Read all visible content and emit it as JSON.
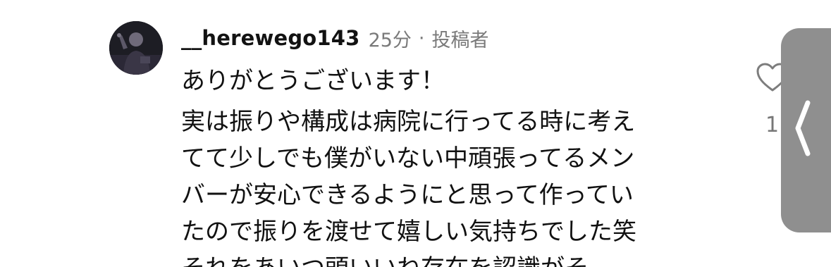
{
  "comment": {
    "username": "__herewego143",
    "time": "25分",
    "separator": "·",
    "role": "投稿者",
    "text_line1": "ありがとうございます！",
    "paragraph_lines": [
      "実は振りや構成は病院に行ってる時に考え",
      "てて少しでも僕がいない中頑張ってるメン",
      "バーが安心できるようにと思って作ってい",
      "たので振りを渡せて嬉しい気持ちでした笑",
      "それをあいつ頭いいね存在を認識がそ"
    ],
    "like_count": "1",
    "avatar_icon": "user-avatar-photo",
    "like_icon": "heart-outline-icon",
    "handle_icon": "chevron-left-icon"
  },
  "colors": {
    "background": "#ffffff",
    "username": "#121212",
    "meta": "#7a7a7a",
    "side_handle": "#8f8f8f"
  }
}
